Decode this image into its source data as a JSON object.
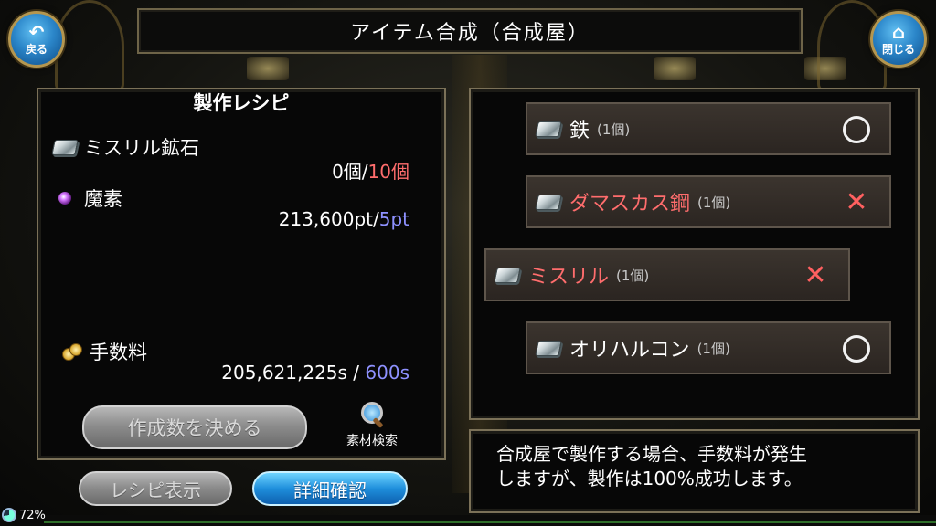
{
  "header": {
    "title": "アイテム合成（合成屋）",
    "back_label": "戻る",
    "close_label": "閉じる"
  },
  "recipe": {
    "title": "製作レシピ",
    "ingredients": [
      {
        "name": "ミスリル鉱石",
        "icon": "ore-icon",
        "have": "0個",
        "separator": "/",
        "need": "10個"
      },
      {
        "name": "魔素",
        "icon": "magic-orb-icon",
        "have": "213,600pt",
        "separator": "/",
        "need": "5pt"
      }
    ],
    "fee": {
      "label": "手数料",
      "icon": "coins-icon",
      "have": "205,621,225s",
      "separator": " / ",
      "need": "600s"
    },
    "decide_button": "作成数を決める",
    "search_label": "素材検索"
  },
  "bottom_buttons": {
    "recipe_display": "レシピ表示",
    "details": "詳細確認"
  },
  "materials": [
    {
      "name": "鉄",
      "count": "(1個)",
      "status": "circle",
      "color": "white"
    },
    {
      "name": "ダマスカス鋼",
      "count": "(1個)",
      "status": "cross",
      "color": "red"
    },
    {
      "name": "ミスリル",
      "count": "(1個)",
      "status": "cross",
      "color": "red"
    },
    {
      "name": "オリハルコン",
      "count": "(1個)",
      "status": "circle",
      "color": "white"
    }
  ],
  "message": {
    "line1": "合成屋で製作する場合、手数料が発生",
    "line2": "しますが、製作は100%成功します。"
  },
  "status_bar": {
    "battery": "72%"
  },
  "colors": {
    "need_red": "#ff6d6d",
    "need_blue": "#8e91ff",
    "panel_border": "#7b7158",
    "button_blue": "#1f8fdc"
  }
}
